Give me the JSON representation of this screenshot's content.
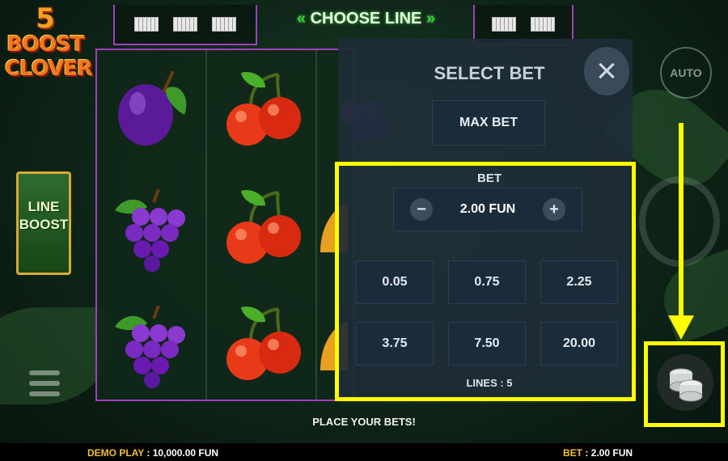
{
  "logo": {
    "number": "5",
    "word1": "BOOST",
    "word2": "CLOVER"
  },
  "line_boost": {
    "line1": "LINE",
    "line2": "BOOST"
  },
  "header": {
    "choose_line": "CHOOSE LINE",
    "arrow_left": "«",
    "arrow_right": "»"
  },
  "panel": {
    "title": "SELECT BET",
    "close_icon": "×",
    "max_bet_label": "MAX BET",
    "bet_label": "BET",
    "bet_value": "2.00 FUN",
    "minus": "−",
    "plus": "+",
    "options": [
      "0.05",
      "0.75",
      "2.25",
      "3.75",
      "7.50",
      "20.00"
    ],
    "lines_label": "LINES : 5"
  },
  "controls": {
    "auto_label": "AUTO"
  },
  "status": {
    "message": "PLACE YOUR BETS!"
  },
  "bottom": {
    "demo_label": "DEMO PLAY",
    "demo_value": ": 10,000.00 FUN",
    "bet_label": "BET",
    "bet_value": ": 2.00 FUN"
  },
  "colors": {
    "highlight": "#ffff00",
    "frame": "#a040c0",
    "accent_green": "#40d040"
  }
}
